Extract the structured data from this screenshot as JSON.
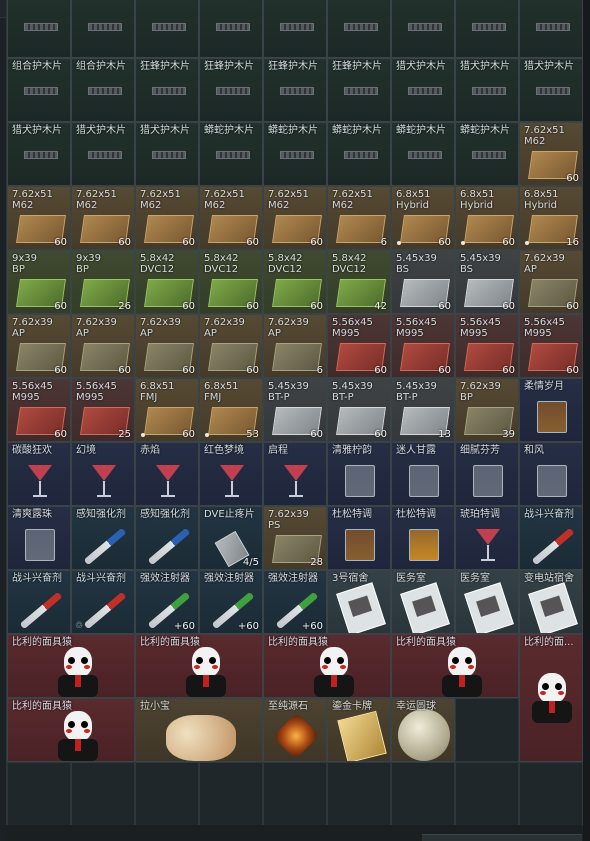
{
  "columns": 9,
  "colors": {
    "background": "#1c2125",
    "grid": "#222a2e",
    "cell_border": "#3a4347"
  },
  "cells": [
    {
      "row": 0,
      "col": 0,
      "w": 1,
      "h": 1,
      "name": "",
      "type": "armor",
      "art": "strip"
    },
    {
      "row": 0,
      "col": 1,
      "w": 1,
      "h": 1,
      "name": "",
      "type": "armor",
      "art": "strip"
    },
    {
      "row": 0,
      "col": 2,
      "w": 1,
      "h": 1,
      "name": "",
      "type": "armor",
      "art": "strip"
    },
    {
      "row": 0,
      "col": 3,
      "w": 1,
      "h": 1,
      "name": "",
      "type": "armor",
      "art": "strip"
    },
    {
      "row": 0,
      "col": 4,
      "w": 1,
      "h": 1,
      "name": "",
      "type": "armor",
      "art": "strip"
    },
    {
      "row": 0,
      "col": 5,
      "w": 1,
      "h": 1,
      "name": "",
      "type": "armor",
      "art": "strip"
    },
    {
      "row": 0,
      "col": 6,
      "w": 1,
      "h": 1,
      "name": "",
      "type": "armor",
      "art": "strip"
    },
    {
      "row": 0,
      "col": 7,
      "w": 1,
      "h": 1,
      "name": "",
      "type": "armor",
      "art": "strip"
    },
    {
      "row": 0,
      "col": 8,
      "w": 1,
      "h": 1,
      "name": "",
      "type": "armor",
      "art": "strip"
    },
    {
      "row": 1,
      "col": 0,
      "w": 1,
      "h": 1,
      "name": "组合护木片",
      "type": "armor",
      "art": "strip"
    },
    {
      "row": 1,
      "col": 1,
      "w": 1,
      "h": 1,
      "name": "组合护木片",
      "type": "armor",
      "art": "strip"
    },
    {
      "row": 1,
      "col": 2,
      "w": 1,
      "h": 1,
      "name": "狂蜂护木片",
      "type": "armor",
      "art": "strip"
    },
    {
      "row": 1,
      "col": 3,
      "w": 1,
      "h": 1,
      "name": "狂蜂护木片",
      "type": "armor",
      "art": "strip"
    },
    {
      "row": 1,
      "col": 4,
      "w": 1,
      "h": 1,
      "name": "狂蜂护木片",
      "type": "armor",
      "art": "strip"
    },
    {
      "row": 1,
      "col": 5,
      "w": 1,
      "h": 1,
      "name": "狂蜂护木片",
      "type": "armor",
      "art": "strip"
    },
    {
      "row": 1,
      "col": 6,
      "w": 1,
      "h": 1,
      "name": "猎犬护木片",
      "type": "armor",
      "art": "strip"
    },
    {
      "row": 1,
      "col": 7,
      "w": 1,
      "h": 1,
      "name": "猎犬护木片",
      "type": "armor",
      "art": "strip"
    },
    {
      "row": 1,
      "col": 8,
      "w": 1,
      "h": 1,
      "name": "猎犬护木片",
      "type": "armor",
      "art": "strip"
    },
    {
      "row": 2,
      "col": 0,
      "w": 1,
      "h": 1,
      "name": "猎犬护木片",
      "type": "armor",
      "art": "strip"
    },
    {
      "row": 2,
      "col": 1,
      "w": 1,
      "h": 1,
      "name": "猎犬护木片",
      "type": "armor",
      "art": "strip"
    },
    {
      "row": 2,
      "col": 2,
      "w": 1,
      "h": 1,
      "name": "猎犬护木片",
      "type": "armor",
      "art": "strip"
    },
    {
      "row": 2,
      "col": 3,
      "w": 1,
      "h": 1,
      "name": "蟒蛇护木片",
      "type": "armor",
      "art": "strip"
    },
    {
      "row": 2,
      "col": 4,
      "w": 1,
      "h": 1,
      "name": "蟒蛇护木片",
      "type": "armor",
      "art": "strip"
    },
    {
      "row": 2,
      "col": 5,
      "w": 1,
      "h": 1,
      "name": "蟒蛇护木片",
      "type": "armor",
      "art": "strip"
    },
    {
      "row": 2,
      "col": 6,
      "w": 1,
      "h": 1,
      "name": "蟒蛇护木片",
      "type": "armor",
      "art": "strip"
    },
    {
      "row": 2,
      "col": 7,
      "w": 1,
      "h": 1,
      "name": "蟒蛇护木片",
      "type": "armor",
      "art": "strip"
    },
    {
      "row": 2,
      "col": 8,
      "w": 1,
      "h": 1,
      "name": "7.62x51\nM62",
      "count": "60",
      "type": "ammo",
      "art": "box"
    },
    {
      "row": 3,
      "col": 0,
      "w": 1,
      "h": 1,
      "name": "7.62x51\nM62",
      "count": "60",
      "type": "ammo",
      "art": "box"
    },
    {
      "row": 3,
      "col": 1,
      "w": 1,
      "h": 1,
      "name": "7.62x51\nM62",
      "count": "60",
      "type": "ammo",
      "art": "box"
    },
    {
      "row": 3,
      "col": 2,
      "w": 1,
      "h": 1,
      "name": "7.62x51\nM62",
      "count": "60",
      "type": "ammo",
      "art": "box"
    },
    {
      "row": 3,
      "col": 3,
      "w": 1,
      "h": 1,
      "name": "7.62x51\nM62",
      "count": "60",
      "type": "ammo",
      "art": "box"
    },
    {
      "row": 3,
      "col": 4,
      "w": 1,
      "h": 1,
      "name": "7.62x51\nM62",
      "count": "60",
      "type": "ammo",
      "art": "box"
    },
    {
      "row": 3,
      "col": 5,
      "w": 1,
      "h": 1,
      "name": "7.62x51\nM62",
      "count": "6",
      "type": "ammo",
      "art": "box"
    },
    {
      "row": 3,
      "col": 6,
      "w": 1,
      "h": 1,
      "name": "6.8x51\nHybrid",
      "count": "60",
      "dot": true,
      "type": "ammo",
      "art": "box"
    },
    {
      "row": 3,
      "col": 7,
      "w": 1,
      "h": 1,
      "name": "6.8x51\nHybrid",
      "count": "60",
      "dot": true,
      "type": "ammo",
      "art": "box"
    },
    {
      "row": 3,
      "col": 8,
      "w": 1,
      "h": 1,
      "name": "6.8x51\nHybrid",
      "count": "16",
      "dot": true,
      "type": "ammo",
      "art": "box"
    },
    {
      "row": 4,
      "col": 0,
      "w": 1,
      "h": 1,
      "name": "9x39\nBP",
      "count": "60",
      "type": "ammo-green",
      "art": "boxg"
    },
    {
      "row": 4,
      "col": 1,
      "w": 1,
      "h": 1,
      "name": "9x39\nBP",
      "count": "26",
      "type": "ammo-green",
      "art": "boxg"
    },
    {
      "row": 4,
      "col": 2,
      "w": 1,
      "h": 1,
      "name": "5.8x42\nDVC12",
      "count": "60",
      "type": "ammo-green",
      "art": "boxg"
    },
    {
      "row": 4,
      "col": 3,
      "w": 1,
      "h": 1,
      "name": "5.8x42\nDVC12",
      "count": "60",
      "type": "ammo-green",
      "art": "boxg"
    },
    {
      "row": 4,
      "col": 4,
      "w": 1,
      "h": 1,
      "name": "5.8x42\nDVC12",
      "count": "60",
      "type": "ammo-green",
      "art": "boxg"
    },
    {
      "row": 4,
      "col": 5,
      "w": 1,
      "h": 1,
      "name": "5.8x42\nDVC12",
      "count": "42",
      "type": "ammo-green",
      "art": "boxg"
    },
    {
      "row": 4,
      "col": 6,
      "w": 1,
      "h": 1,
      "name": "5.45x39\nBS",
      "count": "60",
      "type": "ammo-grey",
      "art": "boxs"
    },
    {
      "row": 4,
      "col": 7,
      "w": 1,
      "h": 1,
      "name": "5.45x39\nBS",
      "count": "60",
      "type": "ammo-grey",
      "art": "boxs"
    },
    {
      "row": 4,
      "col": 8,
      "w": 1,
      "h": 1,
      "name": "7.62x39\nAP",
      "count": "60",
      "type": "ammo",
      "art": "boxk"
    },
    {
      "row": 5,
      "col": 0,
      "w": 1,
      "h": 1,
      "name": "7.62x39\nAP",
      "count": "60",
      "type": "ammo",
      "art": "boxk"
    },
    {
      "row": 5,
      "col": 1,
      "w": 1,
      "h": 1,
      "name": "7.62x39\nAP",
      "count": "60",
      "type": "ammo",
      "art": "boxk"
    },
    {
      "row": 5,
      "col": 2,
      "w": 1,
      "h": 1,
      "name": "7.62x39\nAP",
      "count": "60",
      "type": "ammo",
      "art": "boxk"
    },
    {
      "row": 5,
      "col": 3,
      "w": 1,
      "h": 1,
      "name": "7.62x39\nAP",
      "count": "60",
      "type": "ammo",
      "art": "boxk"
    },
    {
      "row": 5,
      "col": 4,
      "w": 1,
      "h": 1,
      "name": "7.62x39\nAP",
      "count": "6",
      "type": "ammo",
      "art": "boxk"
    },
    {
      "row": 5,
      "col": 5,
      "w": 1,
      "h": 1,
      "name": "5.56x45\nM995",
      "count": "60",
      "type": "ammo-red",
      "art": "boxr"
    },
    {
      "row": 5,
      "col": 6,
      "w": 1,
      "h": 1,
      "name": "5.56x45\nM995",
      "count": "60",
      "type": "ammo-red",
      "art": "boxr"
    },
    {
      "row": 5,
      "col": 7,
      "w": 1,
      "h": 1,
      "name": "5.56x45\nM995",
      "count": "60",
      "type": "ammo-red",
      "art": "boxr"
    },
    {
      "row": 5,
      "col": 8,
      "w": 1,
      "h": 1,
      "name": "5.56x45\nM995",
      "count": "60",
      "type": "ammo-red",
      "art": "boxr"
    },
    {
      "row": 6,
      "col": 0,
      "w": 1,
      "h": 1,
      "name": "5.56x45\nM995",
      "count": "60",
      "type": "ammo-red",
      "art": "boxr"
    },
    {
      "row": 6,
      "col": 1,
      "w": 1,
      "h": 1,
      "name": "5.56x45\nM995",
      "count": "25",
      "type": "ammo-red",
      "art": "boxr"
    },
    {
      "row": 6,
      "col": 2,
      "w": 1,
      "h": 1,
      "name": "6.8x51\nFMJ",
      "count": "60",
      "dot": true,
      "type": "ammo",
      "art": "box"
    },
    {
      "row": 6,
      "col": 3,
      "w": 1,
      "h": 1,
      "name": "6.8x51\nFMJ",
      "count": "53",
      "dot": true,
      "type": "ammo",
      "art": "box"
    },
    {
      "row": 6,
      "col": 4,
      "w": 1,
      "h": 1,
      "name": "5.45x39\nBT-P",
      "count": "60",
      "type": "ammo-grey",
      "art": "boxs"
    },
    {
      "row": 6,
      "col": 5,
      "w": 1,
      "h": 1,
      "name": "5.45x39\nBT-P",
      "count": "60",
      "type": "ammo-grey",
      "art": "boxs"
    },
    {
      "row": 6,
      "col": 6,
      "w": 1,
      "h": 1,
      "name": "5.45x39\nBT-P",
      "count": "13",
      "type": "ammo-grey",
      "art": "boxs"
    },
    {
      "row": 6,
      "col": 7,
      "w": 1,
      "h": 1,
      "name": "7.62x39\nBP",
      "count": "39",
      "type": "ammo",
      "art": "boxk"
    },
    {
      "row": 6,
      "col": 8,
      "w": 1,
      "h": 1,
      "name": "柔情岁月",
      "type": "drink",
      "art": "tumbler-amber"
    },
    {
      "row": 7,
      "col": 0,
      "w": 1,
      "h": 1,
      "name": "碳酸狂欢",
      "type": "drink",
      "art": "cocktail"
    },
    {
      "row": 7,
      "col": 1,
      "w": 1,
      "h": 1,
      "name": "幻境",
      "type": "drink",
      "art": "cocktail"
    },
    {
      "row": 7,
      "col": 2,
      "w": 1,
      "h": 1,
      "name": "赤焰",
      "type": "drink",
      "art": "cocktail"
    },
    {
      "row": 7,
      "col": 3,
      "w": 1,
      "h": 1,
      "name": "红色梦境",
      "type": "drink",
      "art": "cocktail"
    },
    {
      "row": 7,
      "col": 4,
      "w": 1,
      "h": 1,
      "name": "启程",
      "type": "drink",
      "art": "cocktail"
    },
    {
      "row": 7,
      "col": 5,
      "w": 1,
      "h": 1,
      "name": "清雅柠韵",
      "type": "drink",
      "art": "tumbler"
    },
    {
      "row": 7,
      "col": 6,
      "w": 1,
      "h": 1,
      "name": "迷人甘露",
      "type": "drink",
      "art": "tumbler"
    },
    {
      "row": 7,
      "col": 7,
      "w": 1,
      "h": 1,
      "name": "细腻芬芳",
      "type": "drink",
      "art": "tumbler"
    },
    {
      "row": 7,
      "col": 8,
      "w": 1,
      "h": 1,
      "name": "和风",
      "type": "drink",
      "art": "tumbler"
    },
    {
      "row": 8,
      "col": 0,
      "w": 1,
      "h": 1,
      "name": "清爽露珠",
      "type": "drink",
      "art": "tumbler"
    },
    {
      "row": 8,
      "col": 1,
      "w": 1,
      "h": 1,
      "name": "感知强化剂",
      "type": "med",
      "art": "injector"
    },
    {
      "row": 8,
      "col": 2,
      "w": 1,
      "h": 1,
      "name": "感知强化剂",
      "type": "med",
      "art": "injector"
    },
    {
      "row": 8,
      "col": 3,
      "w": 1,
      "h": 1,
      "name": "DVE止疼片",
      "count": "4/5",
      "type": "med",
      "art": "pills"
    },
    {
      "row": 8,
      "col": 4,
      "w": 1,
      "h": 1,
      "name": "7.62x39\nPS",
      "count": "28",
      "type": "ammo",
      "art": "boxk"
    },
    {
      "row": 8,
      "col": 5,
      "w": 1,
      "h": 1,
      "name": "杜松特调",
      "type": "drink",
      "art": "tumbler-amber"
    },
    {
      "row": 8,
      "col": 6,
      "w": 1,
      "h": 1,
      "name": "杜松特调",
      "type": "drink",
      "art": "tumbler-orange"
    },
    {
      "row": 8,
      "col": 7,
      "w": 1,
      "h": 1,
      "name": "琥珀特调",
      "type": "drink",
      "art": "cocktail"
    },
    {
      "row": 8,
      "col": 8,
      "w": 1,
      "h": 1,
      "name": "战斗兴奋剂",
      "type": "med",
      "art": "injector-red"
    },
    {
      "row": 9,
      "col": 0,
      "w": 1,
      "h": 1,
      "name": "战斗兴奋剂",
      "type": "med",
      "art": "injector-red"
    },
    {
      "row": 9,
      "col": 1,
      "w": 1,
      "h": 1,
      "name": "战斗兴奋剂",
      "type": "med",
      "art": "injector-red",
      "lefticon": "♲"
    },
    {
      "row": 9,
      "col": 2,
      "w": 1,
      "h": 1,
      "name": "强效注射器",
      "count": "+60",
      "type": "med",
      "art": "injector-green"
    },
    {
      "row": 9,
      "col": 3,
      "w": 1,
      "h": 1,
      "name": "强效注射器",
      "count": "+60",
      "type": "med",
      "art": "injector-green"
    },
    {
      "row": 9,
      "col": 4,
      "w": 1,
      "h": 1,
      "name": "强效注射器",
      "count": "+60",
      "type": "med",
      "art": "injector-green"
    },
    {
      "row": 9,
      "col": 5,
      "w": 1,
      "h": 1,
      "name": "3号宿舍",
      "type": "key",
      "art": "card"
    },
    {
      "row": 9,
      "col": 6,
      "w": 1,
      "h": 1,
      "name": "医务室",
      "type": "key",
      "art": "card"
    },
    {
      "row": 9,
      "col": 7,
      "w": 1,
      "h": 1,
      "name": "医务室",
      "type": "key",
      "art": "card"
    },
    {
      "row": 9,
      "col": 8,
      "w": 1,
      "h": 1,
      "name": "变电站宿舍",
      "type": "key",
      "art": "card"
    },
    {
      "row": 10,
      "col": 0,
      "w": 2,
      "h": 1,
      "name": "比利的面具猿",
      "type": "red",
      "art": "puppet"
    },
    {
      "row": 10,
      "col": 2,
      "w": 2,
      "h": 1,
      "name": "比利的面具猿",
      "type": "red",
      "art": "puppet"
    },
    {
      "row": 10,
      "col": 4,
      "w": 2,
      "h": 1,
      "name": "比利的面具猿",
      "type": "red",
      "art": "puppet"
    },
    {
      "row": 10,
      "col": 6,
      "w": 2,
      "h": 1,
      "name": "比利的面具猿",
      "type": "red",
      "art": "puppet"
    },
    {
      "row": 10,
      "col": 8,
      "w": 1,
      "h": 2,
      "name": "比利的面...",
      "type": "red",
      "art": "puppet"
    },
    {
      "row": 11,
      "col": 0,
      "w": 2,
      "h": 1,
      "name": "比利的面具猿",
      "type": "red",
      "art": "puppet"
    },
    {
      "row": 11,
      "col": 2,
      "w": 2,
      "h": 1,
      "name": "拉小宝",
      "type": "gold",
      "art": "mask"
    },
    {
      "row": 11,
      "col": 4,
      "w": 1,
      "h": 1,
      "name": "至纯源石",
      "type": "gold",
      "art": "gem"
    },
    {
      "row": 11,
      "col": 5,
      "w": 1,
      "h": 1,
      "name": "鎏金卡牌",
      "type": "gold",
      "art": "goldcard"
    },
    {
      "row": 11,
      "col": 6,
      "w": 1,
      "h": 1,
      "name": "幸运圆球",
      "type": "gold",
      "art": "sphere"
    },
    {
      "row": 11,
      "col": 7,
      "w": 1,
      "h": 1,
      "name": "",
      "type": "empty",
      "art": ""
    },
    {
      "row": 12,
      "col": 0,
      "w": 1,
      "h": 1,
      "name": "",
      "type": "empty",
      "art": ""
    },
    {
      "row": 12,
      "col": 1,
      "w": 1,
      "h": 1,
      "name": "",
      "type": "empty",
      "art": ""
    },
    {
      "row": 12,
      "col": 2,
      "w": 1,
      "h": 1,
      "name": "",
      "type": "empty",
      "art": ""
    },
    {
      "row": 12,
      "col": 3,
      "w": 1,
      "h": 1,
      "name": "",
      "type": "empty",
      "art": ""
    },
    {
      "row": 12,
      "col": 4,
      "w": 1,
      "h": 1,
      "name": "",
      "type": "empty",
      "art": ""
    },
    {
      "row": 12,
      "col": 5,
      "w": 1,
      "h": 1,
      "name": "",
      "type": "empty",
      "art": ""
    },
    {
      "row": 12,
      "col": 6,
      "w": 1,
      "h": 1,
      "name": "",
      "type": "empty",
      "art": ""
    },
    {
      "row": 12,
      "col": 7,
      "w": 1,
      "h": 1,
      "name": "",
      "type": "empty",
      "art": ""
    },
    {
      "row": 12,
      "col": 8,
      "w": 1,
      "h": 1,
      "name": "",
      "type": "empty",
      "art": ""
    }
  ]
}
